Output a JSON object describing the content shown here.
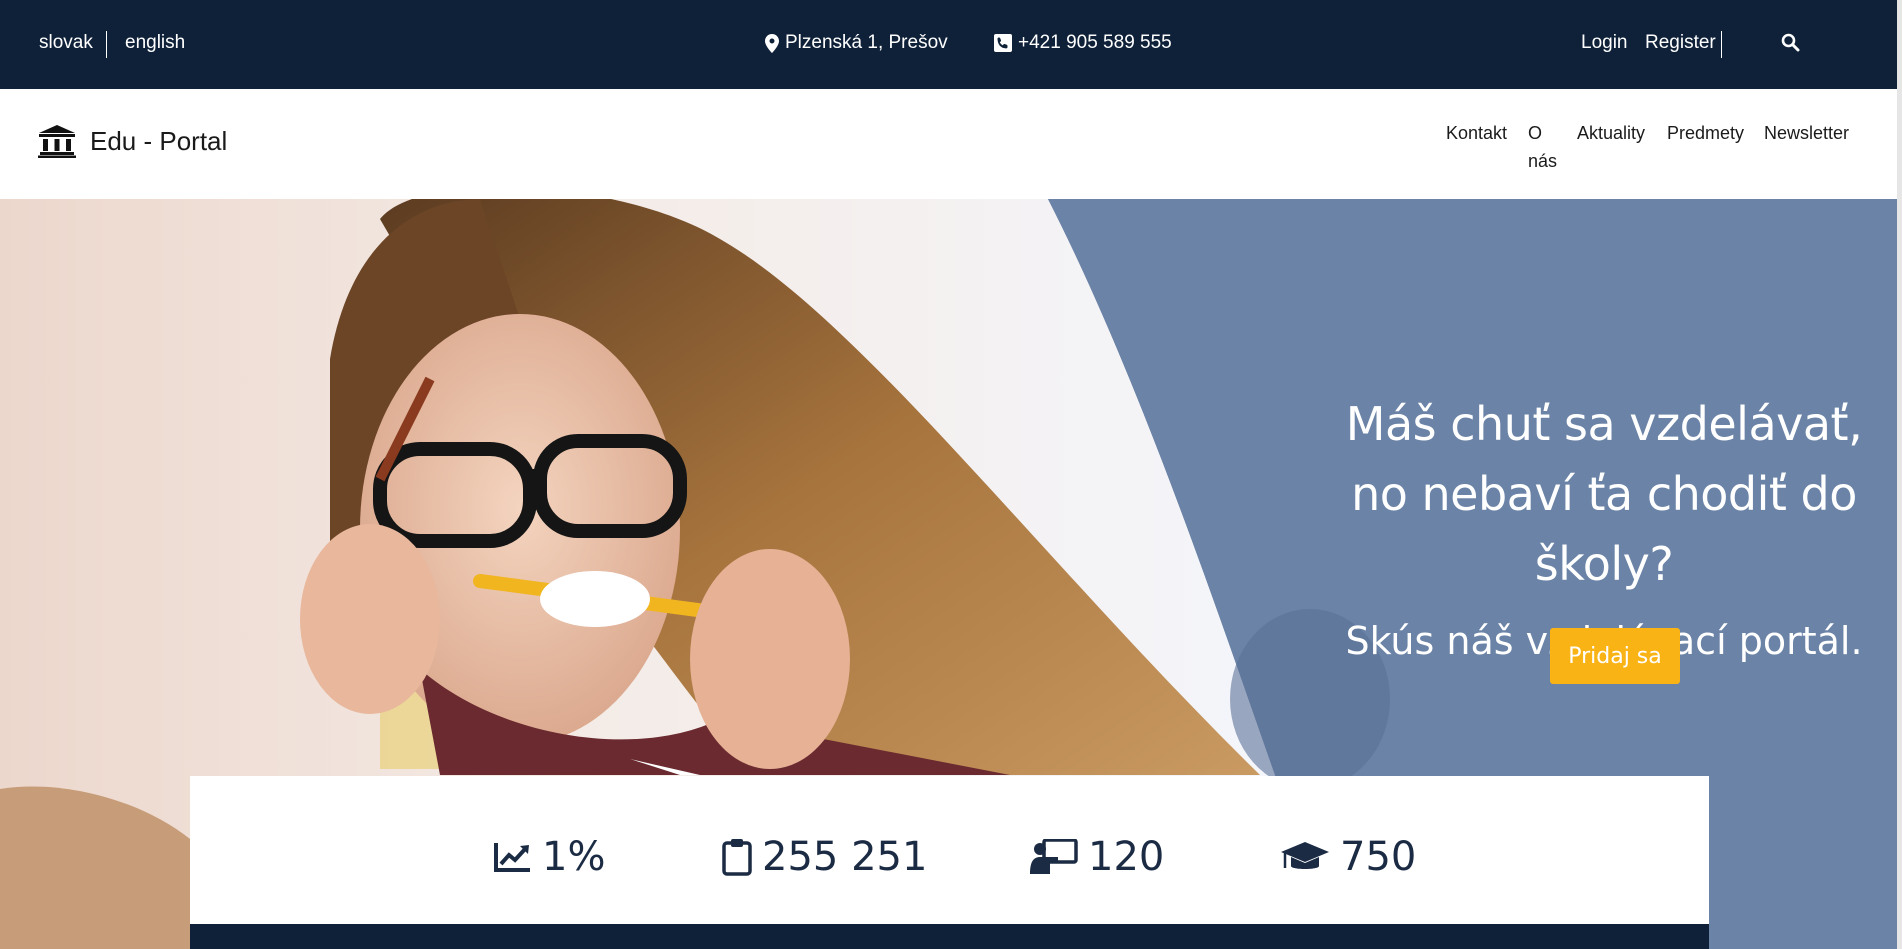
{
  "topbar": {
    "lang_slovak": "slovak",
    "lang_english": "english",
    "address": "Plzenská 1, Prešov",
    "phone": "+421 905 589 555",
    "login": "Login",
    "register": "Register",
    "icons": [
      "map-marker-icon",
      "phone-icon",
      "search-icon"
    ]
  },
  "nav": {
    "brand": "Edu - Portal",
    "links": [
      "Kontakt",
      "O nás",
      "Aktuality",
      "Predmety",
      "Newsletter"
    ]
  },
  "hero": {
    "line1": "Máš chuť sa vzdelávať,",
    "line2": "no nebaví ťa chodiť do školy?",
    "line3": "Skús náš vzdelávací portál.",
    "cta": "Pridaj sa"
  },
  "stats": [
    {
      "icon": "chart-line-icon",
      "value": "1%"
    },
    {
      "icon": "clipboard-icon",
      "value": "255 251"
    },
    {
      "icon": "chalkboard-teacher-icon",
      "value": "120"
    },
    {
      "icon": "graduation-cap-icon",
      "value": "750"
    }
  ],
  "colors": {
    "topbar_bg": "#0f2139",
    "hero_bg": "#6a83a6",
    "cta_bg": "#f9b315",
    "stat_text": "#1c2b44"
  }
}
